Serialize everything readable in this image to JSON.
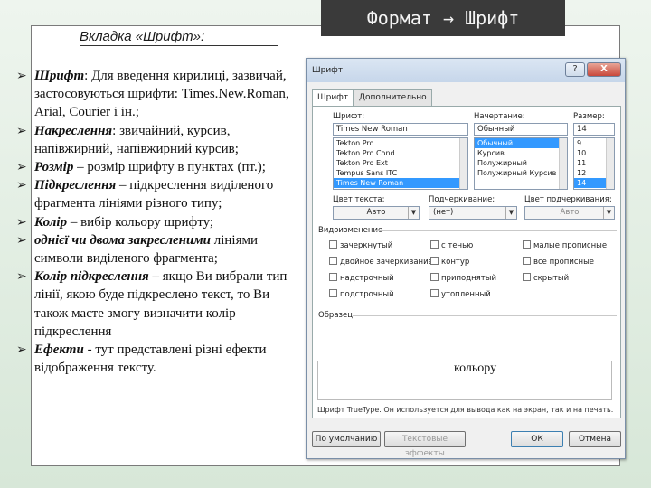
{
  "slide": {
    "title": "Формат → Шрифт",
    "subtitle": "Вкладка «Шрифт»:",
    "bullets": [
      {
        "term": "Шрифт",
        "sep": ": ",
        "text": "Для введення кирилиці, зазвичай, застосовуються шрифти: Times.New.Roman, Arial, Courier і ін.;"
      },
      {
        "term": "Накреслення",
        "sep": ": ",
        "text": "звичайний, курсив, напівжирний, напівжирний курсив;"
      },
      {
        "term": "Розмір",
        "sep": " – ",
        "text": "розмір шрифту в пунктах (пт.);"
      },
      {
        "term": "Підкреслення",
        "sep": " – ",
        "text": "підкреслення виділеного фрагмента лініями різного типу;"
      },
      {
        "term": "Колір",
        "sep": " – ",
        "text": "вибір кольору шрифту;"
      },
      {
        "term": "однієї чи двома закресленими",
        "sep": " ",
        "text": "лініями символи виділеного фрагмента;"
      },
      {
        "term": "Колір підкреслення",
        "sep": " – ",
        "text": "якщо Ви вибрали тип лінії, якою буде підкреслено текст, то Ви також маєте змогу визначити колір підкреслення"
      },
      {
        "term": "Ефекти",
        "sep": " - ",
        "text": "тут представлені різні ефекти відображення тексту."
      }
    ]
  },
  "dialog": {
    "title": "Шрифт",
    "help_label": "?",
    "close_label": "X",
    "tabs": [
      "Шрифт",
      "Дополнительно"
    ],
    "font_label": "Шрифт:",
    "font_value": "Times New Roman",
    "font_list": [
      "Tekton Pro",
      "Tekton Pro Cond",
      "Tekton Pro Ext",
      "Tempus Sans ITC",
      "Times New Roman"
    ],
    "style_label": "Начертание:",
    "style_value": "Обычный",
    "style_list": [
      "Обычный",
      "Курсив",
      "Полужирный",
      "Полужирный Курсив"
    ],
    "size_label": "Размер:",
    "size_value": "14",
    "size_list": [
      "9",
      "10",
      "11",
      "12",
      "14"
    ],
    "color_label": "Цвет текста:",
    "color_value": "Авто",
    "underline_label": "Подчеркивание:",
    "underline_value": "(нет)",
    "underline_color_label": "Цвет подчеркивания:",
    "underline_color_value": "Авто",
    "effects_label": "Видоизменение",
    "effects": [
      "зачеркнутый",
      "с тенью",
      "малые прописные",
      "двойное зачеркивание",
      "контур",
      "все прописные",
      "надстрочный",
      "приподнятый",
      "скрытый",
      "подстрочный",
      "утопленный"
    ],
    "preview_label": "Образец",
    "preview_text": "кольору",
    "note": "Шрифт TrueType. Он используется для вывода как на экран, так и на печать.",
    "buttons": {
      "default": "По умолчанию",
      "effects": "Текстовые эффекты",
      "ok": "ОК",
      "cancel": "Отмена"
    }
  }
}
